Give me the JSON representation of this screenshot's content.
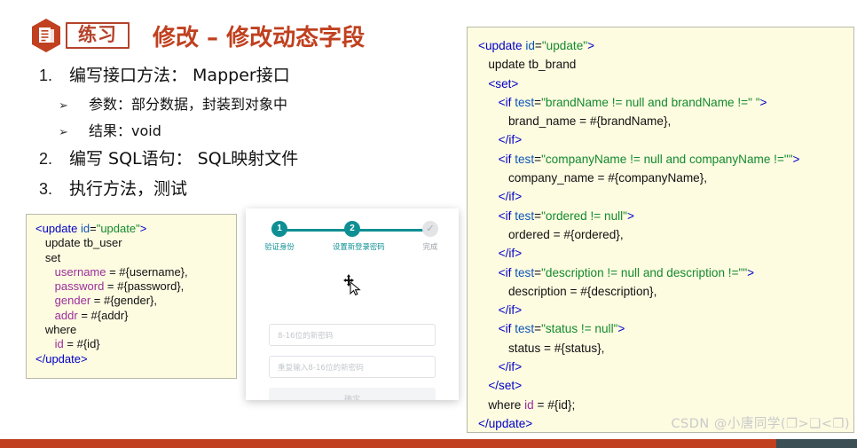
{
  "slide": {
    "badge_label": "练习",
    "title": "修改 – 修改动态字段",
    "logo_icon": "document-hexagon-icon",
    "accent_color": "#c0401f",
    "badge_color": "#b5432c"
  },
  "bullets": [
    {
      "mark": "1.",
      "level": 1,
      "text": "编写接口方法：  Mapper接口"
    },
    {
      "mark": "➢",
      "level": 2,
      "text": "参数：部分数据，封装到对象中"
    },
    {
      "mark": "➢",
      "level": 2,
      "text": "结果：void"
    },
    {
      "mark": "2.",
      "level": 1,
      "text": "编写 SQL语句：  SQL映射文件"
    },
    {
      "mark": "3.",
      "level": 1,
      "text": "执行方法，测试"
    }
  ],
  "code_left": {
    "background": "#fdfbe0",
    "lines": [
      [
        {
          "t": "<",
          "c": "tag"
        },
        {
          "t": "update",
          "c": "tag"
        },
        {
          "t": " ",
          "c": "pln"
        },
        {
          "t": "id",
          "c": "attr"
        },
        {
          "t": "=",
          "c": "pln"
        },
        {
          "t": "\"update\"",
          "c": "str"
        },
        {
          "t": ">",
          "c": "tag"
        }
      ],
      [
        {
          "t": "   update tb_user",
          "c": "pln"
        }
      ],
      [
        {
          "t": "   set",
          "c": "pln"
        }
      ],
      [
        {
          "t": "      ",
          "c": "pln"
        },
        {
          "t": "username",
          "c": "fld"
        },
        {
          "t": " = #{username},",
          "c": "pln"
        }
      ],
      [
        {
          "t": "      ",
          "c": "pln"
        },
        {
          "t": "password",
          "c": "fld"
        },
        {
          "t": " = #{password},",
          "c": "pln"
        }
      ],
      [
        {
          "t": "      ",
          "c": "pln"
        },
        {
          "t": "gender",
          "c": "fld"
        },
        {
          "t": " = #{gender},",
          "c": "pln"
        }
      ],
      [
        {
          "t": "      ",
          "c": "pln"
        },
        {
          "t": "addr",
          "c": "fld"
        },
        {
          "t": " = #{addr}",
          "c": "pln"
        }
      ],
      [
        {
          "t": "   where",
          "c": "pln"
        }
      ],
      [
        {
          "t": "      ",
          "c": "pln"
        },
        {
          "t": "id",
          "c": "fld"
        },
        {
          "t": " = #{id}",
          "c": "pln"
        }
      ],
      [
        {
          "t": "</",
          "c": "tag"
        },
        {
          "t": "update",
          "c": "tag"
        },
        {
          "t": ">",
          "c": "tag"
        }
      ]
    ]
  },
  "code_right": {
    "background": "#fdfbe0",
    "lines": [
      [
        {
          "t": "<",
          "c": "tag"
        },
        {
          "t": "update",
          "c": "tag"
        },
        {
          "t": " ",
          "c": "pln"
        },
        {
          "t": "id",
          "c": "attr"
        },
        {
          "t": "=",
          "c": "pln"
        },
        {
          "t": "\"update\"",
          "c": "str"
        },
        {
          "t": ">",
          "c": "tag"
        }
      ],
      [
        {
          "t": "   update tb_brand",
          "c": "pln"
        }
      ],
      [
        {
          "t": "   <",
          "c": "tag"
        },
        {
          "t": "set",
          "c": "tag"
        },
        {
          "t": ">",
          "c": "tag"
        }
      ],
      [
        {
          "t": "      <",
          "c": "tag"
        },
        {
          "t": "if ",
          "c": "tag"
        },
        {
          "t": "test",
          "c": "attr"
        },
        {
          "t": "=",
          "c": "pln"
        },
        {
          "t": "\"brandName != null and brandName !=\" \"",
          "c": "str"
        },
        {
          "t": ">",
          "c": "tag"
        }
      ],
      [
        {
          "t": "         brand_name = #{brandName},",
          "c": "pln"
        }
      ],
      [
        {
          "t": "      </",
          "c": "tag"
        },
        {
          "t": "if",
          "c": "tag"
        },
        {
          "t": ">",
          "c": "tag"
        }
      ],
      [
        {
          "t": "      <",
          "c": "tag"
        },
        {
          "t": "if ",
          "c": "tag"
        },
        {
          "t": "test",
          "c": "attr"
        },
        {
          "t": "=",
          "c": "pln"
        },
        {
          "t": "\"companyName != null and companyName !=\"\"",
          "c": "str"
        },
        {
          "t": ">",
          "c": "tag"
        }
      ],
      [
        {
          "t": "         company_name = #{companyName},",
          "c": "pln"
        }
      ],
      [
        {
          "t": "      </",
          "c": "tag"
        },
        {
          "t": "if",
          "c": "tag"
        },
        {
          "t": ">",
          "c": "tag"
        }
      ],
      [
        {
          "t": "      <",
          "c": "tag"
        },
        {
          "t": "if ",
          "c": "tag"
        },
        {
          "t": "test",
          "c": "attr"
        },
        {
          "t": "=",
          "c": "pln"
        },
        {
          "t": "\"ordered != null\"",
          "c": "str"
        },
        {
          "t": ">",
          "c": "tag"
        }
      ],
      [
        {
          "t": "         ordered = #{ordered},",
          "c": "pln"
        }
      ],
      [
        {
          "t": "      </",
          "c": "tag"
        },
        {
          "t": "if",
          "c": "tag"
        },
        {
          "t": ">",
          "c": "tag"
        }
      ],
      [
        {
          "t": "      <",
          "c": "tag"
        },
        {
          "t": "if ",
          "c": "tag"
        },
        {
          "t": "test",
          "c": "attr"
        },
        {
          "t": "=",
          "c": "pln"
        },
        {
          "t": "\"description != null and description !=\"\"",
          "c": "str"
        },
        {
          "t": ">",
          "c": "tag"
        }
      ],
      [
        {
          "t": "         description = #{description},",
          "c": "pln"
        }
      ],
      [
        {
          "t": "      </",
          "c": "tag"
        },
        {
          "t": "if",
          "c": "tag"
        },
        {
          "t": ">",
          "c": "tag"
        }
      ],
      [
        {
          "t": "      <",
          "c": "tag"
        },
        {
          "t": "if ",
          "c": "tag"
        },
        {
          "t": "test",
          "c": "attr"
        },
        {
          "t": "=",
          "c": "pln"
        },
        {
          "t": "\"status != null\"",
          "c": "str"
        },
        {
          "t": ">",
          "c": "tag"
        }
      ],
      [
        {
          "t": "         status = #{status},",
          "c": "pln"
        }
      ],
      [
        {
          "t": "      </",
          "c": "tag"
        },
        {
          "t": "if",
          "c": "tag"
        },
        {
          "t": ">",
          "c": "tag"
        }
      ],
      [
        {
          "t": "   </",
          "c": "tag"
        },
        {
          "t": "set",
          "c": "tag"
        },
        {
          "t": ">",
          "c": "tag"
        }
      ],
      [
        {
          "t": "   where ",
          "c": "pln"
        },
        {
          "t": "id",
          "c": "fld"
        },
        {
          "t": " = #{id};",
          "c": "pln"
        }
      ],
      [
        {
          "t": "</",
          "c": "tag"
        },
        {
          "t": "update",
          "c": "tag"
        },
        {
          "t": ">",
          "c": "tag"
        }
      ]
    ]
  },
  "card": {
    "active_color": "#0e8f93",
    "steps": [
      {
        "number": "1",
        "label": "验证身份",
        "state": "done"
      },
      {
        "number": "2",
        "label": "设置新登录密码",
        "state": "active"
      },
      {
        "number": "✓",
        "label": "完成",
        "state": "pending"
      }
    ],
    "password_placeholder": "8-16位的新密码",
    "confirm_placeholder": "重复输入8-16位的新密码",
    "password_value": "",
    "confirm_value": "",
    "submit_label": "确定",
    "cursor_icon": "move-cursor-icon"
  },
  "watermark": "CSDN @小唐同学(❐>❏<❐)"
}
